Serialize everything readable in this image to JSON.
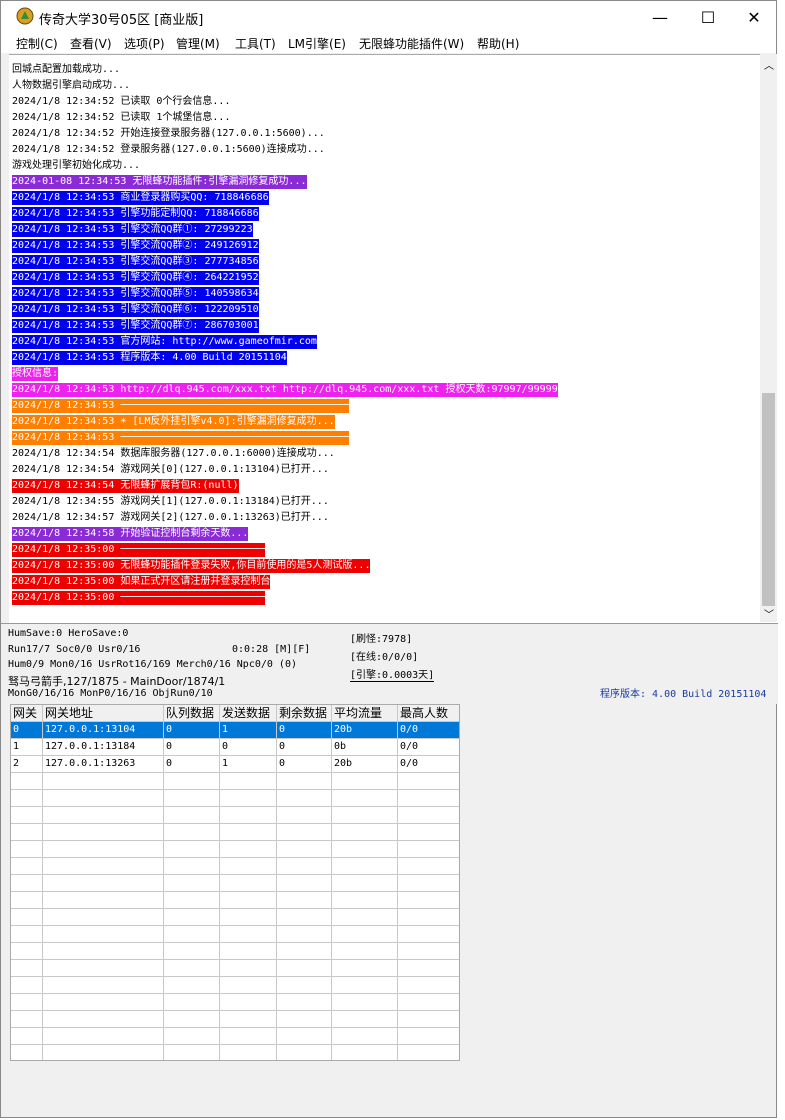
{
  "window": {
    "title": "传奇大学30号05区 [商业版]",
    "minimize_glyph": "—",
    "maximize_glyph": "☐",
    "close_glyph": "✕"
  },
  "menu": [
    "控制(C)",
    "查看(V)",
    "选项(P)",
    "管理(M)",
    "工具(T)",
    "LM引擎(E)",
    "无限蜂功能插件(W)",
    "帮助(H)"
  ],
  "log": [
    {
      "text": "回城点配置加载成功...",
      "bg": "",
      "fg": "#000000"
    },
    {
      "text": "人物数据引擎启动成功...",
      "bg": "",
      "fg": "#000000"
    },
    {
      "text": "2024/1/8 12:34:52 已读取 0个行会信息...",
      "bg": "",
      "fg": "#000000"
    },
    {
      "text": "2024/1/8 12:34:52 已读取 1个城堡信息...",
      "bg": "",
      "fg": "#000000"
    },
    {
      "text": "2024/1/8 12:34:52 开始连接登录服务器(127.0.0.1:5600)...",
      "bg": "",
      "fg": "#000000"
    },
    {
      "text": "2024/1/8 12:34:52 登录服务器(127.0.0.1:5600)连接成功...",
      "bg": "",
      "fg": "#000000"
    },
    {
      "text": "游戏处理引擎初始化成功...",
      "bg": "",
      "fg": "#000000"
    },
    {
      "text": "2024-01-08 12:34:53 无限蜂功能插件:引擎漏洞修复成功...",
      "bg": "#8b2bd6",
      "fg": "#ffffff"
    },
    {
      "text": "2024/1/8 12:34:53 商业登录器购买QQ: 718846686",
      "bg": "#0000ee",
      "fg": "#ffffff"
    },
    {
      "text": "2024/1/8 12:34:53 引擎功能定制QQ: 718846686",
      "bg": "#0000ee",
      "fg": "#ffffff"
    },
    {
      "text": "2024/1/8 12:34:53 引擎交流QQ群①: 27299223",
      "bg": "#0000ee",
      "fg": "#ffffff"
    },
    {
      "text": "2024/1/8 12:34:53 引擎交流QQ群②: 249126912",
      "bg": "#0000ee",
      "fg": "#ffffff"
    },
    {
      "text": "2024/1/8 12:34:53 引擎交流QQ群③: 277734856",
      "bg": "#0000ee",
      "fg": "#ffffff"
    },
    {
      "text": "2024/1/8 12:34:53 引擎交流QQ群④: 264221952",
      "bg": "#0000ee",
      "fg": "#ffffff"
    },
    {
      "text": "2024/1/8 12:34:53 引擎交流QQ群⑤: 140598634",
      "bg": "#0000ee",
      "fg": "#ffffff"
    },
    {
      "text": "2024/1/8 12:34:53 引擎交流QQ群⑥: 122209510",
      "bg": "#0000ee",
      "fg": "#ffffff"
    },
    {
      "text": "2024/1/8 12:34:53 引擎交流QQ群⑦: 286703001",
      "bg": "#0000ee",
      "fg": "#ffffff"
    },
    {
      "text": "2024/1/8 12:34:53 官方网站: http://www.gameofmir.com",
      "bg": "#0000ee",
      "fg": "#ffffff"
    },
    {
      "text": "2024/1/8 12:34:53 程序版本: 4.00 Build 20151104",
      "bg": "#0000ee",
      "fg": "#ffffff"
    },
    {
      "text": "授权信息:",
      "bg": "#ee22ee",
      "fg": "#ffffff"
    },
    {
      "text": "2024/1/8 12:34:53 http://dlq.945.com/xxx.txt http://dlq.945.com/xxx.txt 授权天数:97997/99999",
      "bg": "#ee22ee",
      "fg": "#ffffff"
    },
    {
      "text": "2024/1/8 12:34:53 ──────────────────────────────────────",
      "bg": "#ff7f00",
      "fg": "#ffffff"
    },
    {
      "text": "2024/1/8 12:34:53 ☀ [LM反外挂引擎v4.0]:引擎漏洞修复成功...",
      "bg": "#ff7f00",
      "fg": "#ffffff"
    },
    {
      "text": "2024/1/8 12:34:53 ──────────────────────────────────────",
      "bg": "#ff7f00",
      "fg": "#ffffff"
    },
    {
      "text": "2024/1/8 12:34:54 数据库服务器(127.0.0.1:6000)连接成功...",
      "bg": "",
      "fg": "#000000"
    },
    {
      "text": "2024/1/8 12:34:54 游戏网关[0](127.0.0.1:13104)已打开...",
      "bg": "",
      "fg": "#000000"
    },
    {
      "text": "2024/1/8 12:34:54 无限蜂扩展背包R:(null)",
      "bg": "#ee0000",
      "fg": "#ffffff"
    },
    {
      "text": "2024/1/8 12:34:55 游戏网关[1](127.0.0.1:13184)已打开...",
      "bg": "",
      "fg": "#000000"
    },
    {
      "text": "2024/1/8 12:34:57 游戏网关[2](127.0.0.1:13263)已打开...",
      "bg": "",
      "fg": "#000000"
    },
    {
      "text": "2024/1/8 12:34:58 开始验证控制台剩余天数...",
      "bg": "#8b2bd6",
      "fg": "#ffffff"
    },
    {
      "text": "2024/1/8 12:35:00 ────────────────────────",
      "bg": "#ee0000",
      "fg": "#ffffff"
    },
    {
      "text": "2024/1/8 12:35:00 无限蜂功能插件登录失败,你目前使用的是5人测试版...",
      "bg": "#ee0000",
      "fg": "#ffffff"
    },
    {
      "text": "2024/1/8 12:35:00 如果正式开区请注册并登录控制台",
      "bg": "#ee0000",
      "fg": "#ffffff"
    },
    {
      "text": "2024/1/8 12:35:00 ────────────────────────",
      "bg": "#ee0000",
      "fg": "#ffffff"
    }
  ],
  "status": {
    "line1": "HumSave:0 HeroSave:0",
    "line2": "Run17/7 Soc0/0 Usr0/16",
    "line2b": "0:0:28 [M][F]",
    "line3": "Hum0/9 Mon0/16 UsrRot16/169 Merch0/16 Npc0/0 (0)",
    "line4": "驽马弓箭手,127/1875 - MainDoor/1874/1",
    "line5": "MonG0/16/16 MonP0/16/16 ObjRun0/10",
    "right1": "[刷怪:7978]",
    "right2": "[在线:0/0/0]",
    "right3": "[引擎:0.0003天]",
    "version": "程序版本: 4.00 Build 20151104"
  },
  "grid": {
    "headers": [
      "网关",
      "网关地址",
      "队列数据",
      "发送数据",
      "剩余数据",
      "平均流量",
      "最高人数"
    ],
    "rows": [
      [
        "0",
        "127.0.0.1:13104",
        "0",
        "1",
        "0",
        "20b",
        "0/0"
      ],
      [
        "1",
        "127.0.0.1:13184",
        "0",
        "0",
        "0",
        "0b",
        "0/0"
      ],
      [
        "2",
        "127.0.0.1:13263",
        "0",
        "1",
        "0",
        "20b",
        "0/0"
      ]
    ],
    "selected_color": "#0078d7"
  }
}
